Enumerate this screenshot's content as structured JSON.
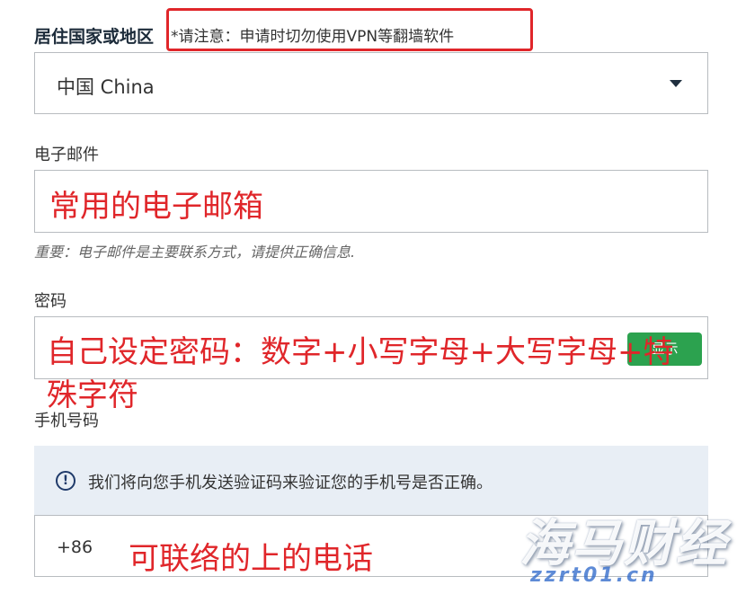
{
  "country": {
    "label": "居住国家或地区",
    "note": "*请注意：申请时切勿使用VPN等翻墙软件",
    "selected": "中国 China"
  },
  "email": {
    "label": "电子邮件",
    "annotation": "常用的电子邮箱",
    "hint": "重要：电子邮件是主要联系方式，请提供正确信息."
  },
  "password": {
    "label": "密码",
    "show_button": "显示",
    "annotation_line1": "自己设定密码：数字+小写字母+大写字母+特",
    "annotation_line2": "殊字符"
  },
  "phone": {
    "label": "手机号码",
    "info_text": "我们将向您手机发送验证码来验证您的手机号是否正确。",
    "country_code": "+86",
    "annotation": "可联络的上的电话"
  },
  "watermark": {
    "brand": "海马财经",
    "domain": "zzrt01.cn"
  },
  "colors": {
    "annotation_red": "#e0262a",
    "button_green": "#2ca24f",
    "info_bg": "#e8eef5"
  }
}
